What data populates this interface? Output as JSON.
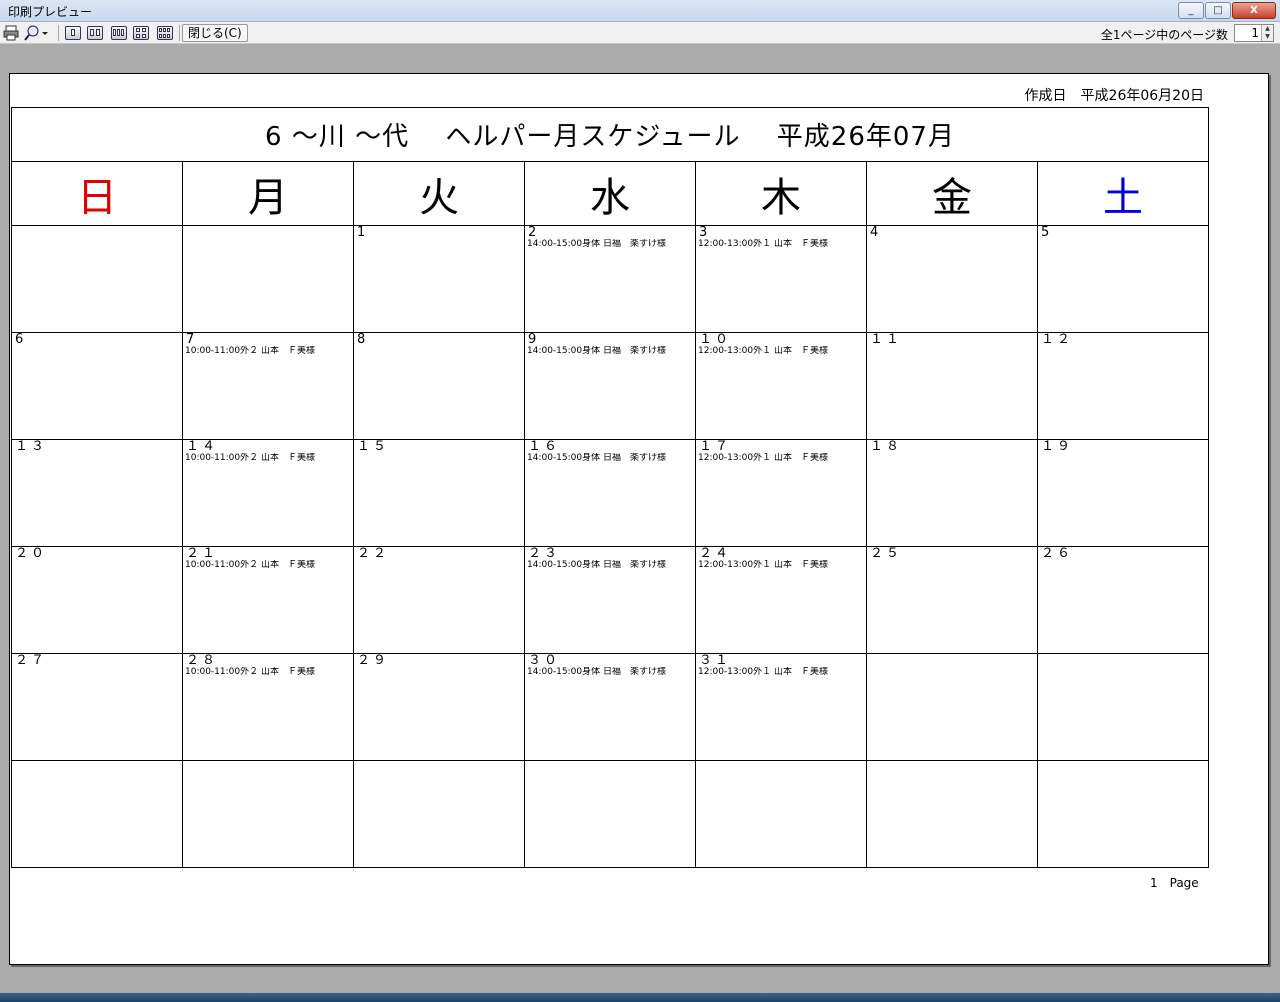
{
  "window": {
    "title": "印刷プレビュー",
    "min": "_",
    "max": "□",
    "close": "X"
  },
  "toolbar": {
    "close_label": "閉じる(C)",
    "pages_label": "全1ページ中のページ数",
    "page_value": "1"
  },
  "paper": {
    "created": "作成日　平成26年06月20日",
    "title": "6 ～川 ～代　 ヘルパー月スケジュール　 平成26年07月",
    "page_footer": "1　Page"
  },
  "weekdays": [
    "日",
    "月",
    "火",
    "水",
    "木",
    "金",
    "土"
  ],
  "weeks": [
    [
      {
        "d": "",
        "e": ""
      },
      {
        "d": "",
        "e": ""
      },
      {
        "d": "1",
        "e": ""
      },
      {
        "d": "2",
        "e": "14:00-15:00身体 日福　楽すけ様"
      },
      {
        "d": "3",
        "e": "12:00-13:00外１ 山本　Ｆ美様"
      },
      {
        "d": "4",
        "e": ""
      },
      {
        "d": "5",
        "e": ""
      }
    ],
    [
      {
        "d": "6",
        "e": ""
      },
      {
        "d": "7",
        "e": "10:00-11:00外２ 山本　Ｆ美様"
      },
      {
        "d": "8",
        "e": ""
      },
      {
        "d": "9",
        "e": "14:00-15:00身体 日福　楽すけ様"
      },
      {
        "d": "１０",
        "e": "12:00-13:00外１ 山本　Ｆ美様"
      },
      {
        "d": "１１",
        "e": ""
      },
      {
        "d": "１２",
        "e": ""
      }
    ],
    [
      {
        "d": "１３",
        "e": ""
      },
      {
        "d": "１４",
        "e": "10:00-11:00外２ 山本　Ｆ美様"
      },
      {
        "d": "１５",
        "e": ""
      },
      {
        "d": "１６",
        "e": "14:00-15:00身体 日福　楽すけ様"
      },
      {
        "d": "１７",
        "e": "12:00-13:00外１ 山本　Ｆ美様"
      },
      {
        "d": "１８",
        "e": ""
      },
      {
        "d": "１９",
        "e": ""
      }
    ],
    [
      {
        "d": "２０",
        "e": ""
      },
      {
        "d": "２１",
        "e": "10:00-11:00外２ 山本　Ｆ美様"
      },
      {
        "d": "２２",
        "e": ""
      },
      {
        "d": "２３",
        "e": "14:00-15:00身体 日福　楽すけ様"
      },
      {
        "d": "２４",
        "e": "12:00-13:00外１ 山本　Ｆ美様"
      },
      {
        "d": "２５",
        "e": ""
      },
      {
        "d": "２６",
        "e": ""
      }
    ],
    [
      {
        "d": "２７",
        "e": ""
      },
      {
        "d": "２８",
        "e": "10:00-11:00外２ 山本　Ｆ美様"
      },
      {
        "d": "２９",
        "e": ""
      },
      {
        "d": "３０",
        "e": "14:00-15:00身体 日福　楽すけ様"
      },
      {
        "d": "３１",
        "e": "12:00-13:00外１ 山本　Ｆ美様"
      },
      {
        "d": "",
        "e": ""
      },
      {
        "d": "",
        "e": ""
      }
    ],
    [
      {
        "d": "",
        "e": ""
      },
      {
        "d": "",
        "e": ""
      },
      {
        "d": "",
        "e": ""
      },
      {
        "d": "",
        "e": ""
      },
      {
        "d": "",
        "e": ""
      },
      {
        "d": "",
        "e": ""
      },
      {
        "d": "",
        "e": ""
      }
    ]
  ],
  "colors": {
    "sunday": "#e00000",
    "saturday": "#0000e0"
  }
}
